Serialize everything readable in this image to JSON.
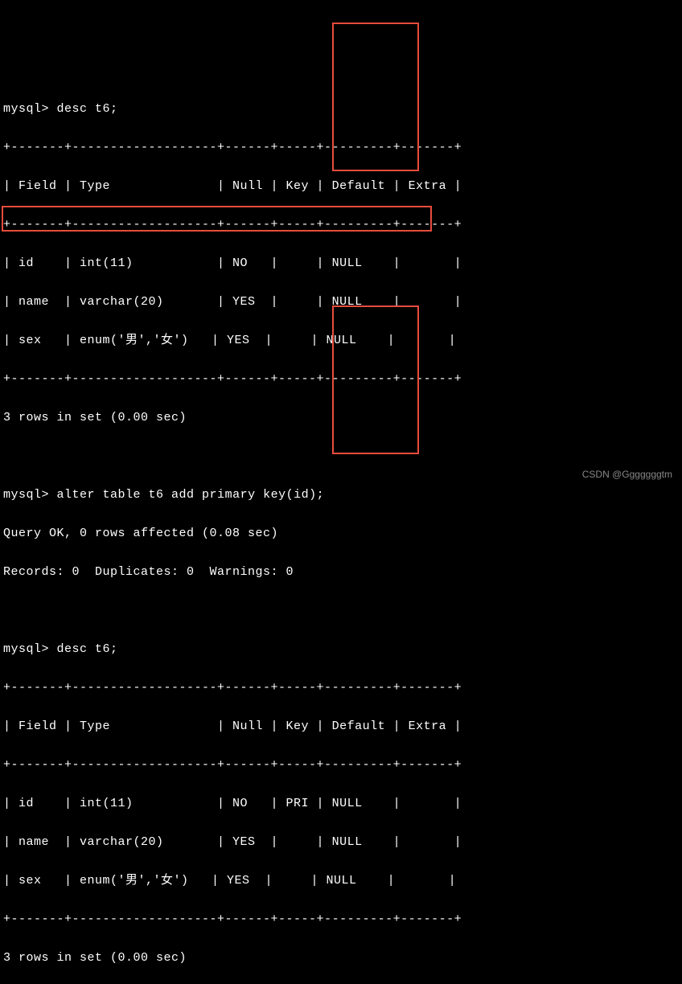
{
  "prompt": "mysql>",
  "commands": {
    "desc1": "desc t6;",
    "alter": "alter table t6 add primary key(id);",
    "desc2": "desc t6;"
  },
  "table_border": "+-------+-------------------+------+-----+---------+-------+",
  "header_cells": {
    "field": "Field",
    "type": "Type",
    "null": "Null",
    "key": "Key",
    "default": "Default",
    "extra": "Extra"
  },
  "header_row": "| Field | Type              | Null | Key | Default | Extra |",
  "desc1_rows": [
    "| id    | int(11)           | NO   |     | NULL    |       |",
    "| name  | varchar(20)       | YES  |     | NULL    |       |",
    "| sex   | enum('男','女')   | YES  |     | NULL    |       |"
  ],
  "desc1_result": "3 rows in set (0.00 sec)",
  "alter_result1": "Query OK, 0 rows affected (0.08 sec)",
  "alter_result2": "Records: 0  Duplicates: 0  Warnings: 0",
  "desc2_rows": [
    "| id    | int(11)           | NO   | PRI | NULL    |       |",
    "| name  | varchar(20)       | YES  |     | NULL    |       |",
    "| sex   | enum('男','女')   | YES  |     | NULL    |       |"
  ],
  "desc2_result": "3 rows in set (0.00 sec)",
  "table1_data": [
    {
      "field": "id",
      "type": "int(11)",
      "null": "NO",
      "key": "",
      "default": "NULL",
      "extra": ""
    },
    {
      "field": "name",
      "type": "varchar(20)",
      "null": "YES",
      "key": "",
      "default": "NULL",
      "extra": ""
    },
    {
      "field": "sex",
      "type": "enum('男','女')",
      "null": "YES",
      "key": "",
      "default": "NULL",
      "extra": ""
    }
  ],
  "table2_data": [
    {
      "field": "id",
      "type": "int(11)",
      "null": "NO",
      "key": "PRI",
      "default": "NULL",
      "extra": ""
    },
    {
      "field": "name",
      "type": "varchar(20)",
      "null": "YES",
      "key": "",
      "default": "NULL",
      "extra": ""
    },
    {
      "field": "sex",
      "type": "enum('男','女')",
      "null": "YES",
      "key": "",
      "default": "NULL",
      "extra": ""
    }
  ],
  "watermark": "CSDN @Gggggggtm"
}
